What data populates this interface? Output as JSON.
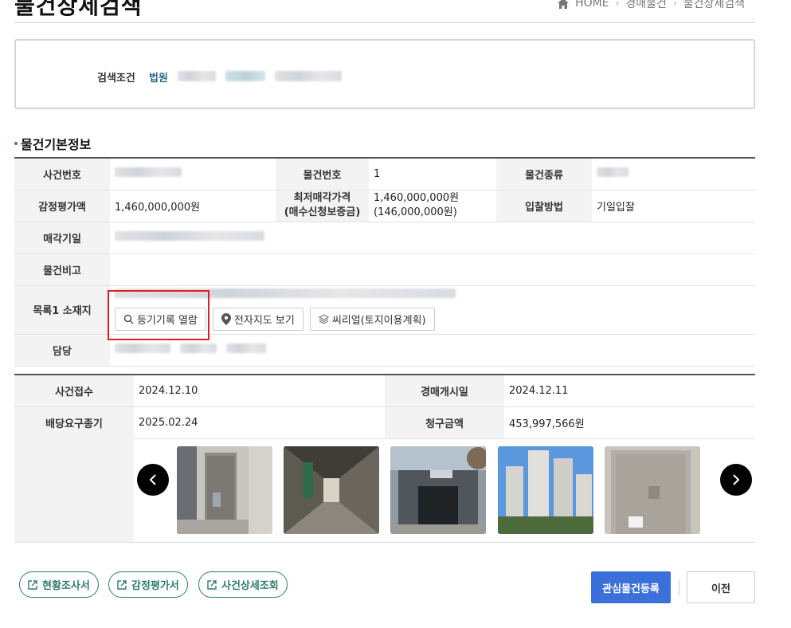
{
  "header": {
    "title": "물건상세검색",
    "breadcrumb": [
      "HOME",
      "경매물건",
      "물건상세검색"
    ]
  },
  "search": {
    "label": "검색조건",
    "court_label": "법원"
  },
  "section": {
    "title": "물건기본정보"
  },
  "basic": {
    "case_no_label": "사건번호",
    "item_no_label": "물건번호",
    "item_no": "1",
    "item_type_label": "물건종류",
    "appraisal_label": "감정평가액",
    "appraisal": "1,460,000,000원",
    "min_price_label_1": "최저매각가격",
    "min_price_label_2": "(매수신청보증금)",
    "min_price": "1,460,000,000원",
    "deposit": "(146,000,000원)",
    "bid_method_label": "입찰방법",
    "bid_method": "기일입찰",
    "sale_date_label": "매각기일",
    "remarks_label": "물건비고",
    "address_label": "목록1 소재지",
    "btn_registry": "등기기록 열람",
    "btn_map": "전자지도 보기",
    "btn_seereal": "씨리얼(토지이용계획)",
    "manager_label": "담당"
  },
  "dates": {
    "receipt_label": "사건접수",
    "receipt": "2024.12.10",
    "start_label": "경매개시일",
    "start": "2024.12.11",
    "deadline_label": "배당요구종기",
    "deadline": "2025.02.24",
    "claim_label": "청구금액",
    "claim": "453,997,566원"
  },
  "actions": {
    "survey": "현황조사서",
    "appraisal_doc": "감정평가서",
    "case_detail": "사건상세조회",
    "register_interest": "관심물건등록",
    "back": "이전"
  },
  "colors": {
    "primary": "#3b6fd9",
    "link_green": "#2e7d6f",
    "highlight": "#e02020"
  }
}
